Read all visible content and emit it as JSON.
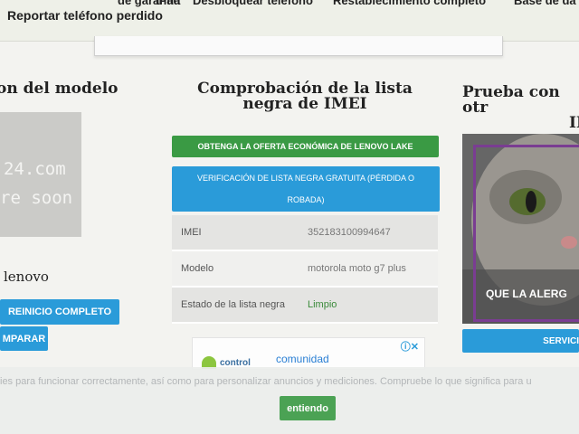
{
  "nav": {
    "menu_items": [
      "de garantía",
      "iPad",
      "Desbloquear teléfono",
      "Restablecimiento completo",
      "Base de da"
    ],
    "sub_item": "Reportar teléfono perdido"
  },
  "left_column": {
    "title": "on del modelo",
    "placeholder_line1": "24.com",
    "placeholder_line2": "re soon",
    "brand": "lenovo",
    "hard_reset_button": "REINICIO COMPLETO",
    "compare_button": "MPARAR"
  },
  "center_column": {
    "title_line1": "Comprobación de la lista",
    "title_line2": "negra de IMEI",
    "offer_button": "OBTENGA LA OFERTA ECONÓMICA DE LENOVO LAKE",
    "blacklist_button_line1": "VERIFICACIÓN DE LISTA NEGRA GRATUITA (PÉRDIDA O",
    "blacklist_button_line2": "ROBADA)",
    "rows": [
      {
        "label": "IMEI",
        "value": "352183100994647"
      },
      {
        "label": "Modelo",
        "value": "motorola moto g7 plus"
      },
      {
        "label": "Estado de la lista negra",
        "value": "Limpio"
      }
    ]
  },
  "ad": {
    "text": "comunidad",
    "brand_partial": "control"
  },
  "right_column": {
    "title_line1": "Prueba con otr",
    "title_line2": "IN",
    "image_caption": "QUE LA ALERG",
    "service_button": "SERVICI"
  },
  "cookie": {
    "text": "ies para funcionar correctamente, así como para personalizar anuncios y mediciones. Compruebe lo que significa para u",
    "accept_button": "entiendo"
  },
  "colors": {
    "blue": "#2a9bd9",
    "green": "#3a9a44",
    "clean_status": "#3a8a3a"
  }
}
